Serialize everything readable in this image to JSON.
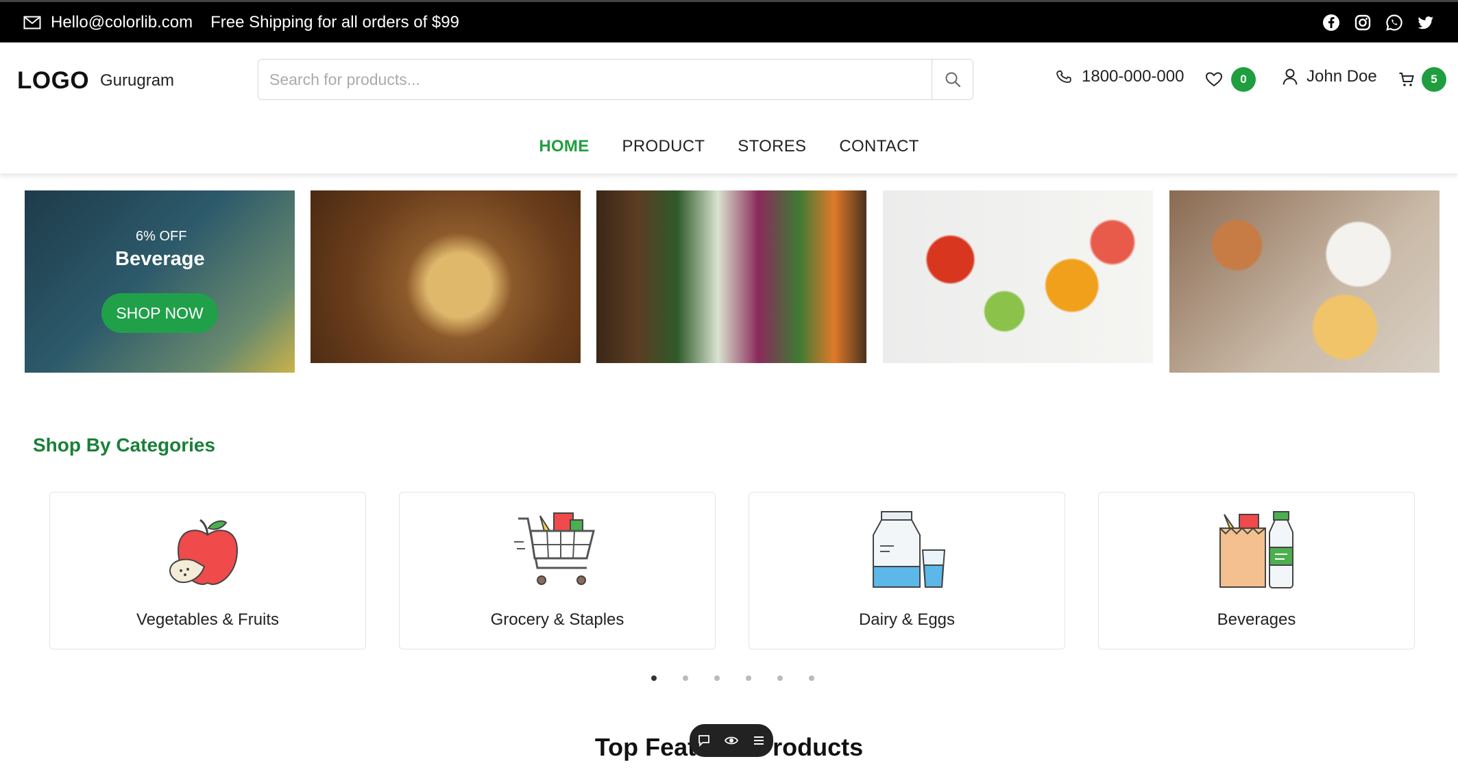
{
  "topbar": {
    "email": "Hello@colorlib.com",
    "shipping": "Free Shipping for all orders of $99",
    "social_icons": [
      "facebook-icon",
      "instagram-icon",
      "whatsapp-icon",
      "twitter-icon"
    ]
  },
  "header": {
    "logo": "LOGO",
    "city": "Gurugram",
    "search_placeholder": "Search for products...",
    "phone": "1800-000-000",
    "wishlist_count": "0",
    "user_name": "John Doe",
    "cart_count": "5"
  },
  "nav": {
    "items": [
      {
        "label": "HOME",
        "active": true
      },
      {
        "label": "PRODUCT",
        "active": false
      },
      {
        "label": "STORES",
        "active": false
      },
      {
        "label": "CONTACT",
        "active": false
      }
    ]
  },
  "banners": {
    "first": {
      "discount": "6% OFF",
      "title": "Beverage",
      "cta": "SHOP NOW"
    }
  },
  "categories": {
    "title": "Shop By Categories",
    "items": [
      {
        "label": "Vegetables & Fruits",
        "icon": "apple-icon"
      },
      {
        "label": "Grocery & Staples",
        "icon": "shopping-cart-icon"
      },
      {
        "label": "Dairy & Eggs",
        "icon": "milk-carton-icon"
      },
      {
        "label": "Beverages",
        "icon": "beverages-bag-icon"
      }
    ],
    "carousel_pages": 6,
    "active_page": 1
  },
  "featured": {
    "title": "Top Featured Products"
  },
  "colors": {
    "accent": "#1f9e3f",
    "topbar_bg": "#000000",
    "category_title": "#1a7f37"
  }
}
